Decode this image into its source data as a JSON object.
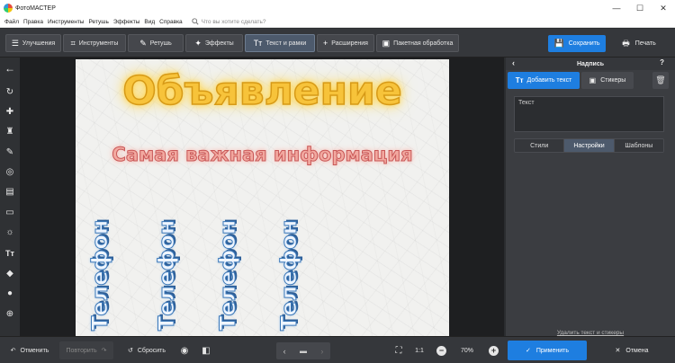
{
  "window": {
    "title": "ФотоМАСТЕР",
    "controls": [
      "—",
      "☐",
      "✕"
    ]
  },
  "menu": {
    "items": [
      "Файл",
      "Правка",
      "Инструменты",
      "Ретушь",
      "Эффекты",
      "Вид",
      "Справка"
    ],
    "search_placeholder": "Что вы хотите сделать?"
  },
  "toolbar": {
    "tabs": [
      "Улучшения",
      "Инструменты",
      "Ретушь",
      "Эффекты",
      "Текст и рамки",
      "Расширения",
      "Пакетная обработка"
    ],
    "active_tab": "Текст и рамки",
    "save_label": "Сохранить",
    "print_label": "Печать"
  },
  "left_tools": [
    "back-arrow-icon",
    "rotate-icon",
    "healing-brush-icon",
    "stamp-icon",
    "brush-icon",
    "target-icon",
    "gradient-filter-icon",
    "vignette-icon",
    "light-icon",
    "text-icon",
    "paint-bucket-icon",
    "color-drop-icon",
    "crosshair-icon"
  ],
  "canvas": {
    "headline": "Объявление",
    "subline": "Самая важная информация",
    "vertical_texts": [
      "Телефон",
      "Телефон",
      "Телефон",
      "Телефон"
    ]
  },
  "right_panel": {
    "title": "Надпись",
    "add_text_label": "Добавить текст",
    "stickers_label": "Стикеры",
    "text_value": "Текст",
    "tabs": [
      "Стили",
      "Настройки",
      "Шаблоны"
    ],
    "active_tab": "Настройки",
    "delete_link": "Удалить текст и стикеры"
  },
  "bottom": {
    "undo": "Отменить",
    "redo": "Повторить",
    "reset": "Сбросить",
    "ratio": "1:1",
    "zoom": "70%",
    "apply": "Применить",
    "cancel": "Отмена"
  },
  "colors": {
    "accent": "#1e7ee0",
    "headline_fill": "#f7c33a",
    "subline_fill": "#f2a9a0",
    "vertical_stroke": "#3d79b8"
  }
}
